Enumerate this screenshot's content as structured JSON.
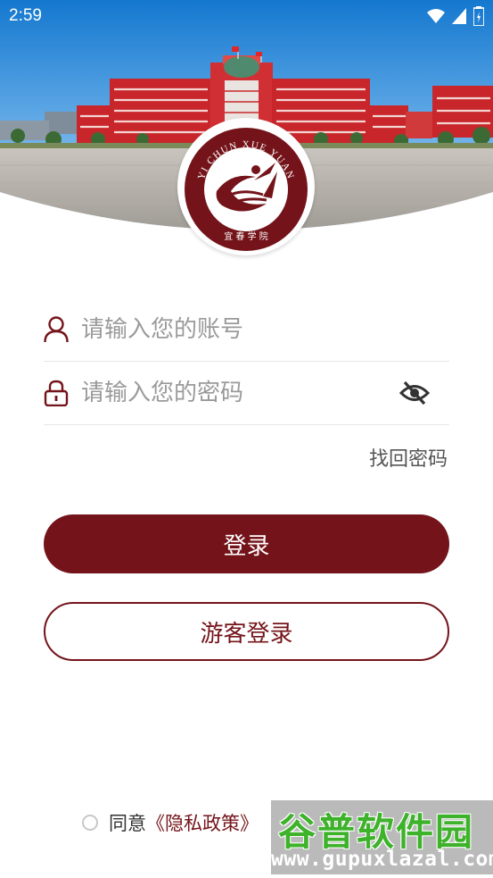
{
  "status_bar": {
    "time": "2:59"
  },
  "logo": {
    "ring_text": "YI CHUN XUE YUAN",
    "bottom_text": "宜 春 学 院"
  },
  "form": {
    "account_placeholder": "请输入您的账号",
    "password_placeholder": "请输入您的密码",
    "forgot_password": "找回密码"
  },
  "buttons": {
    "login": "登录",
    "guest_login": "游客登录"
  },
  "agreement": {
    "prefix": "同意",
    "privacy_link": "《隐私政策》"
  },
  "watermark": {
    "title": "谷普软件园",
    "url": "www.gupuxlazal.com"
  },
  "colors": {
    "accent": "#74141a",
    "sky": "#1a86d8",
    "building": "#c8262a"
  },
  "icons": {
    "account": "user-icon",
    "password": "lock-icon",
    "visibility": "eye-off-icon",
    "wifi": "wifi-icon",
    "signal": "signal-icon",
    "battery": "battery-icon"
  }
}
